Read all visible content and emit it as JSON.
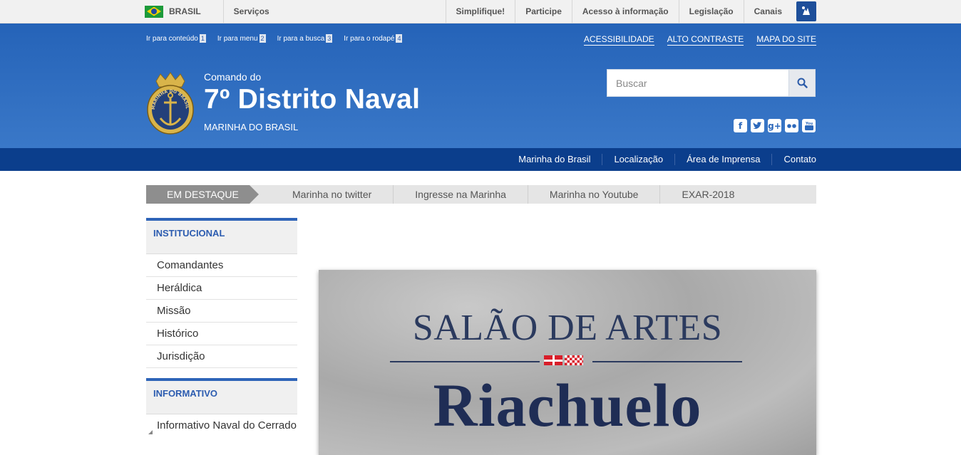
{
  "govbar": {
    "country": "BRASIL",
    "services": "Serviços",
    "links": [
      "Simplifique!",
      "Participe",
      "Acesso à informação",
      "Legislação",
      "Canais"
    ]
  },
  "accessibility": {
    "skip_links": [
      {
        "label": "Ir para conteúdo",
        "key": "1"
      },
      {
        "label": "Ir para menu",
        "key": "2"
      },
      {
        "label": "Ir para a busca",
        "key": "3"
      },
      {
        "label": "Ir para o rodapé",
        "key": "4"
      }
    ],
    "top_links": [
      "ACESSIBILIDADE",
      "ALTO CONTRASTE",
      "MAPA DO SITE"
    ]
  },
  "brand": {
    "pre_title": "Comando do",
    "title": "7º Distrito Naval",
    "subtitle": "MARINHA DO BRASIL",
    "logo_text": "MARINHA DO BRASIL"
  },
  "search": {
    "placeholder": "Buscar"
  },
  "social": [
    "facebook-icon",
    "twitter-icon",
    "googleplus-icon",
    "flickr-icon",
    "youtube-icon"
  ],
  "nav": [
    "Marinha do Brasil",
    "Localização",
    "Área de Imprensa",
    "Contato"
  ],
  "destaque": {
    "label": "EM DESTAQUE",
    "items": [
      "Marinha no twitter",
      "Ingresse na Marinha",
      "Marinha no Youtube",
      "EXAR-2018"
    ]
  },
  "sidebar": {
    "section1": {
      "title": "INSTITUCIONAL",
      "items": [
        "Comandantes",
        "Heráldica",
        "Missão",
        "Histórico",
        "Jurisdição"
      ]
    },
    "section2": {
      "title": "INFORMATIVO",
      "items": [
        "Informativo Naval do Cerrado"
      ]
    }
  },
  "banner": {
    "line1": "SALÃO DE ARTES",
    "line2": "Riachuelo"
  },
  "colors": {
    "header_blue": "#2563b8",
    "nav_blue": "#0b3e8c",
    "accent_blue": "#2e64b8"
  }
}
